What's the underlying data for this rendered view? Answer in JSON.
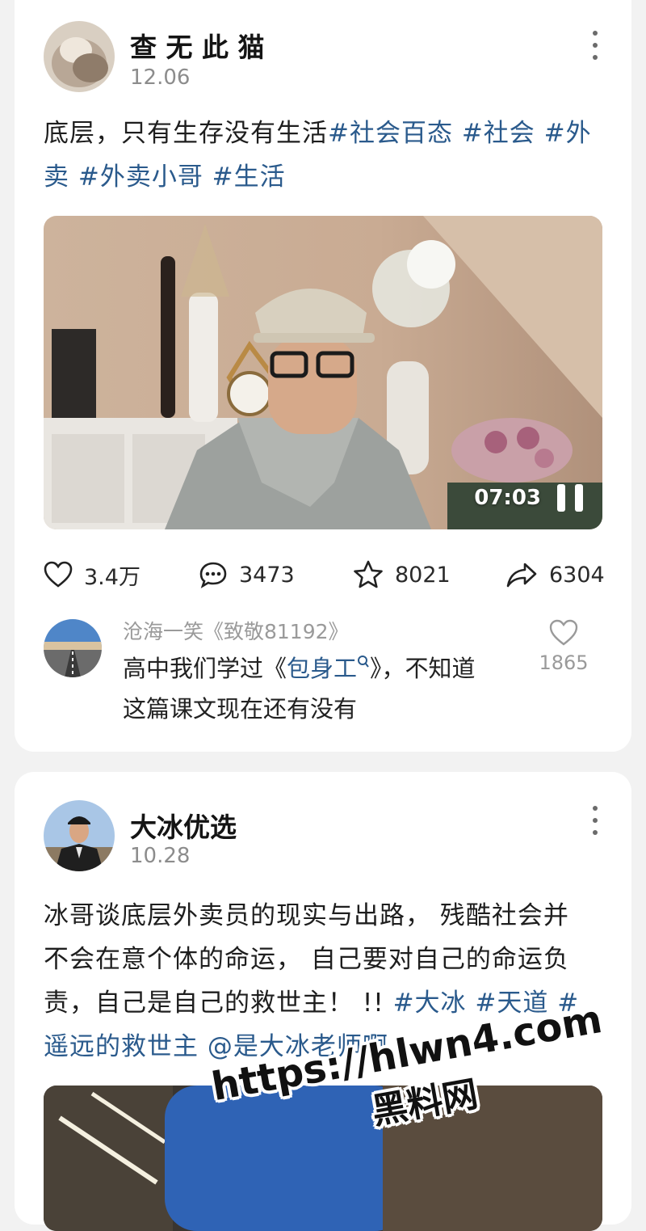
{
  "posts": [
    {
      "author": "查 无 此 猫",
      "date": "12.06",
      "text": "底层，只有生存没有生活",
      "tags_line1": "#社会百态 #社会 #外",
      "tags_line2": "卖 #外卖小哥 #生活",
      "video_duration": "07:03",
      "stats": {
        "likes": "3.4万",
        "comments": "3473",
        "favorites": "8021",
        "shares": "6304"
      },
      "top_comment": {
        "user": "沧海一笑《致敬81192》",
        "text_before": "高中我们学过《",
        "linked_title": "包身工",
        "text_after": "》，不知道这篇课文现在还有没有",
        "likes": "1865"
      }
    },
    {
      "author": "大冰优选",
      "date": "10.28",
      "text_line1": "冰哥谈底层外卖员的现实与出路， 残酷社会并",
      "text_line2": "不会在意个体的命运， 自己要对自己的命运负",
      "text_line3_plain": "责，自己是自己的救世主！ !! ",
      "text_line3_tags": "#大冰 #天道 #",
      "text_line4_tags": "遥远的救世主 @是大冰老师啊"
    }
  ],
  "watermark": {
    "url": "https://hlwn4.com",
    "site": "黑料网"
  },
  "colors": {
    "tag": "#2a5a8c",
    "background": "#f2f2f2",
    "card": "#ffffff"
  },
  "icons": [
    "more-vertical-icon",
    "heart-icon",
    "comment-bubble-icon",
    "star-icon",
    "share-arrow-icon",
    "search-icon",
    "pause-icon"
  ]
}
